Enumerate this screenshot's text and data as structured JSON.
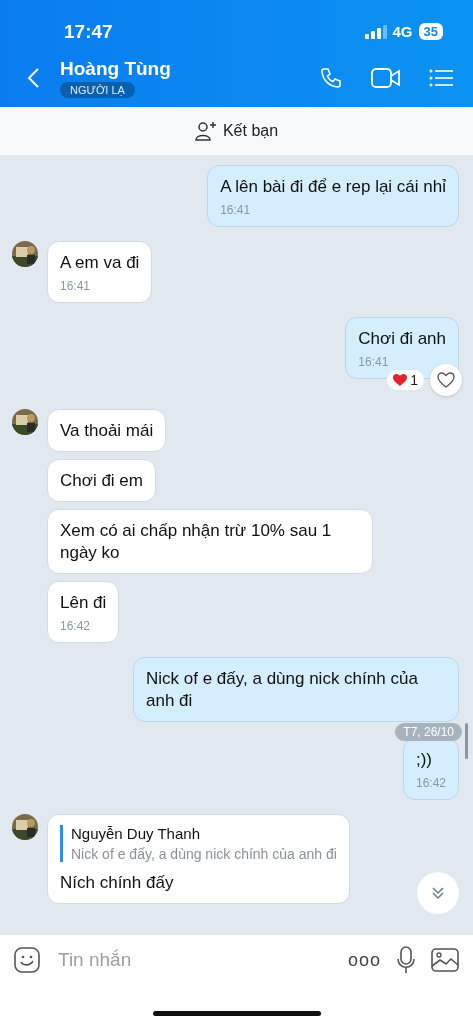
{
  "status_bar": {
    "time": "17:47",
    "network": "4G",
    "battery": "35"
  },
  "header": {
    "name": "Hoàng Tùng",
    "badge": "NGƯỜI LẠ"
  },
  "add_friend": {
    "label": "Kết bạn"
  },
  "messages": [
    {
      "kind": "sent",
      "text": "A lên bài đi để e rep lại cái nhỉ",
      "time": "16:41"
    },
    {
      "kind": "received",
      "avatar": true,
      "text": "A em va đi",
      "time": "16:41"
    },
    {
      "kind": "sent",
      "text": "Chơi đi anh",
      "time": "16:41",
      "reaction_count": "1"
    },
    {
      "kind": "received",
      "avatar": true,
      "text": "Va thoải mái"
    },
    {
      "kind": "received",
      "avatar": false,
      "text": "Chơi đi em"
    },
    {
      "kind": "received",
      "avatar": false,
      "text": "Xem có ai chấp nhận trừ 10% sau 1 ngày ko"
    },
    {
      "kind": "received",
      "avatar": false,
      "text": "Lên đi",
      "time": "16:42"
    },
    {
      "kind": "sent",
      "text": "Nick of e đấy, a dùng nick chính của anh đi"
    },
    {
      "kind": "sent",
      "text": ";))",
      "time": "16:42",
      "date": "T7, 26/10"
    },
    {
      "kind": "received",
      "avatar": true,
      "quote": {
        "author": "Nguyễn Duy Thanh",
        "text": "Nick of e đấy, a dùng nick chính của anh đi"
      },
      "text": "Ních chính đấy"
    }
  ],
  "composer": {
    "placeholder": "Tin nhắn",
    "more": "ooo"
  }
}
